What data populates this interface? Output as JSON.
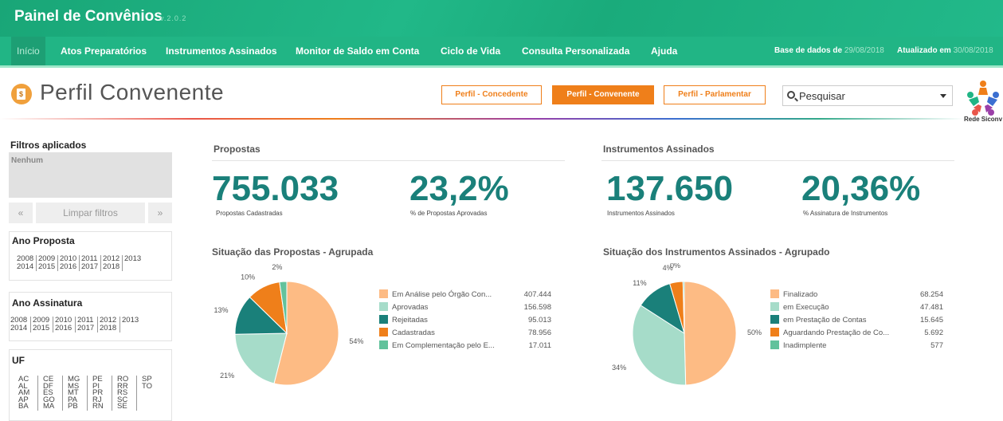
{
  "app": {
    "title": "Painel de Convênios",
    "version": "v.2.0.2"
  },
  "nav": {
    "items": [
      {
        "label": "Início"
      },
      {
        "label": "Atos Preparatórios"
      },
      {
        "label": "Instrumentos Assinados"
      },
      {
        "label": "Monitor de Saldo em Conta"
      },
      {
        "label": "Ciclo de Vida"
      },
      {
        "label": "Consulta Personalizada"
      },
      {
        "label": "Ajuda"
      }
    ],
    "base_label": "Base de dados de",
    "base_date": "29/08/2018",
    "updated_label": "Atualizado em",
    "updated_date": "30/08/2018"
  },
  "header": {
    "title": "Perfil Convenente",
    "icon": "money-document-icon",
    "profiles": [
      "Perfil - Concedente",
      "Perfil - Convenente",
      "Perfil - Parlamentar"
    ],
    "active_profile": "Perfil - Convenente",
    "search_placeholder": "Pesquisar",
    "logo_text": "Rede Siconv"
  },
  "filters": {
    "title": "Filtros aplicados",
    "none": "Nenhum",
    "prev": "«",
    "clear": "Limpar filtros",
    "next": "»",
    "ano_proposta": {
      "title": "Ano Proposta",
      "row1": [
        "2008",
        "2009",
        "2010",
        "2011",
        "2012",
        "2013"
      ],
      "row2": [
        "2014",
        "2015",
        "2016",
        "2017",
        "2018"
      ]
    },
    "ano_assinatura": {
      "title": "Ano Assinatura",
      "row1": [
        "2008",
        "2009",
        "2010",
        "2011",
        "2012",
        "2013"
      ],
      "row2": [
        "2014",
        "2015",
        "2016",
        "2017",
        "2018"
      ]
    },
    "uf": {
      "title": "UF",
      "columns": [
        [
          "AC",
          "AL",
          "AM",
          "AP",
          "BA"
        ],
        [
          "CE",
          "DF",
          "ES",
          "GO",
          "MA"
        ],
        [
          "MG",
          "MS",
          "MT",
          "PA",
          "PB"
        ],
        [
          "PE",
          "PI",
          "PR",
          "RJ",
          "RN"
        ],
        [
          "RO",
          "RR",
          "RS",
          "SC",
          "SE"
        ],
        [
          "SP",
          "TO"
        ]
      ]
    }
  },
  "propostas": {
    "section": "Propostas",
    "kpi1_value": "755.033",
    "kpi1_label": "Propostas Cadastradas",
    "kpi2_value": "23,2%",
    "kpi2_label": "% de Propostas Aprovadas",
    "chart_title": "Situação das Propostas - Agrupada"
  },
  "instrumentos": {
    "section": "Instrumentos Assinados",
    "kpi1_value": "137.650",
    "kpi1_label": "Instrumentos Assinados",
    "kpi2_value": "20,36%",
    "kpi2_label": "% Assinatura de Instrumentos",
    "chart_title": "Situação dos Instrumentos Assinados - Agrupado"
  },
  "chart_data": [
    {
      "type": "pie",
      "title": "Situação das Propostas - Agrupada",
      "categories": [
        "Em Análise pelo Órgão Con...",
        "Aprovadas",
        "Rejeitadas",
        "Cadastradas",
        "Em Complementação pelo E..."
      ],
      "values": [
        407444,
        156598,
        95013,
        78956,
        17011
      ],
      "value_labels": [
        "407.444",
        "156.598",
        "95.013",
        "78.956",
        "17.011"
      ],
      "percent_labels": [
        "54%",
        "21%",
        "13%",
        "10%",
        "2%"
      ],
      "colors": [
        "#fdbb84",
        "#a6dcc9",
        "#1a807a",
        "#ef7f1a",
        "#62c29c"
      ],
      "legend": "right"
    },
    {
      "type": "pie",
      "title": "Situação dos Instrumentos Assinados - Agrupado",
      "categories": [
        "Finalizado",
        "em Execução",
        "em Prestação de Contas",
        "Aguardando Prestação de Co...",
        "Inadimplente"
      ],
      "values": [
        68254,
        47481,
        15645,
        5692,
        577
      ],
      "value_labels": [
        "68.254",
        "47.481",
        "15.645",
        "5.692",
        "577"
      ],
      "percent_labels": [
        "50%",
        "34%",
        "11%",
        "4%",
        "0%"
      ],
      "colors": [
        "#fdbb84",
        "#a6dcc9",
        "#1a807a",
        "#ef7f1a",
        "#62c29c"
      ],
      "legend": "right"
    }
  ]
}
